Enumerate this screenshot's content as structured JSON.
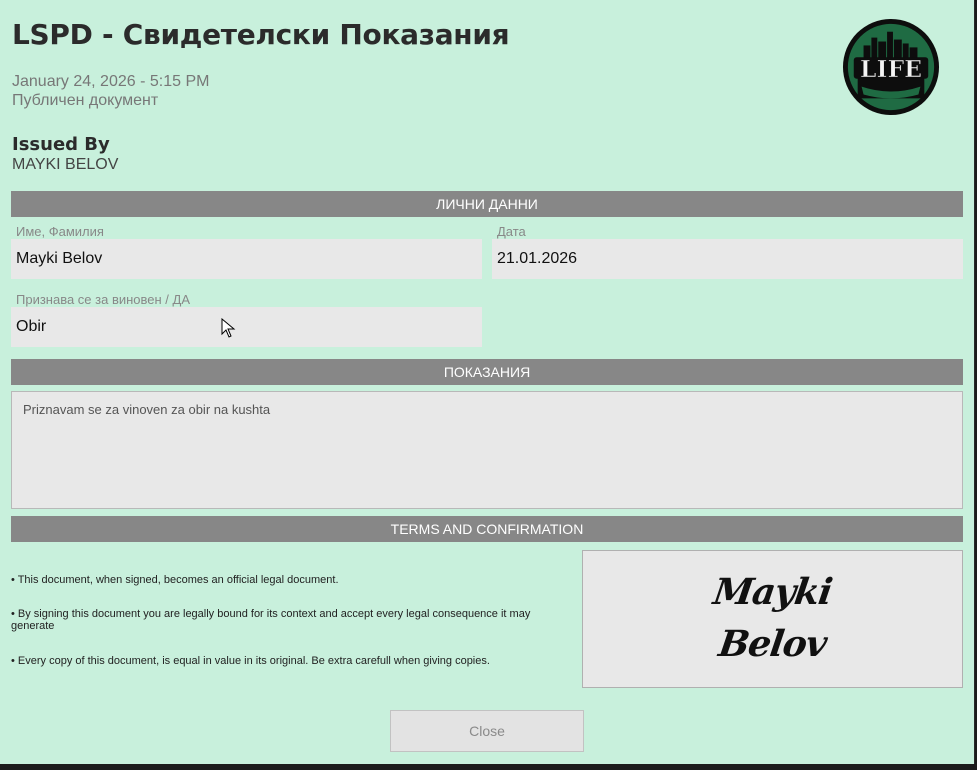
{
  "header": {
    "title": "LSPD - Свидетелски Показания",
    "datetime": "January 24, 2026 - 5:15 PM",
    "doc_type": "Публичен документ",
    "logo_text": "LIFE"
  },
  "issued": {
    "label": "Issued By",
    "name": "MAYKI BELOV"
  },
  "personal": {
    "section_title": "ЛИЧНИ ДАННИ",
    "name_label": "Име, Фамилия",
    "name_value": "Mayki Belov",
    "date_label": "Дата",
    "date_value": "21.01.2026",
    "guilty_label": "Признава се за виновен / ДА",
    "guilty_value": "Obir"
  },
  "testimony": {
    "section_title": "ПОКАЗАНИЯ",
    "text": "Priznavam se za vinoven za obir na kushta"
  },
  "terms": {
    "section_title": "TERMS AND CONFIRMATION",
    "items": [
      "• This document, when signed, becomes an official legal document.",
      "• By signing this document you are legally bound for its context and accept every legal consequence it may generate",
      "• Every copy of this document, is equal in value in its original. Be extra carefull when giving copies."
    ],
    "signature_line1": "Mayki",
    "signature_line2": "Belov"
  },
  "actions": {
    "close_label": "Close"
  },
  "colors": {
    "background": "#c8f0dc",
    "section_bar": "#878787",
    "field_bg": "#e8e8e8"
  }
}
